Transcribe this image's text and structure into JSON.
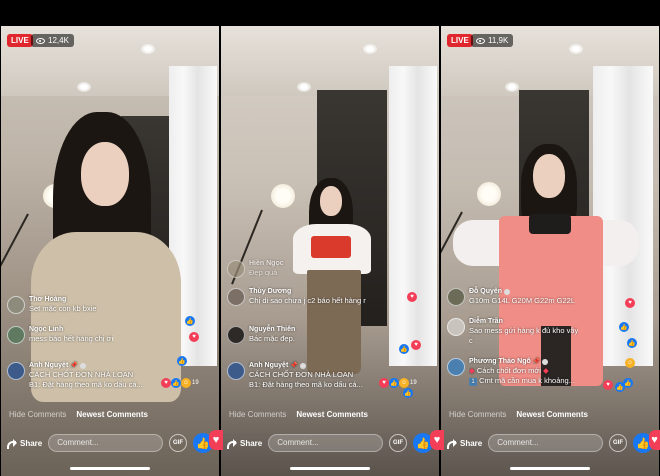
{
  "panels": [
    {
      "live_label": "LIVE",
      "viewers": "12,4K",
      "comments": [
        {
          "name": "Thơ Hoàng",
          "text": "Set mặc con kb bxie",
          "avatar_color": "#8d8b7c"
        },
        {
          "name": "Ngọc Linh",
          "text": "mess báo hết hàng chị ơi",
          "avatar_color": "#5f7a61"
        },
        {
          "name": "Anh Nguyệt",
          "text_line1": "CÁCH CHỐT ĐƠN NHÀ LOAN",
          "text_line2": "B1: Đặt hàng theo mã ko dấu cá...",
          "avatar_color": "#3c5a8a",
          "pinned": true
        }
      ],
      "react_count": "19",
      "tabs": {
        "hide": "Hide Comments",
        "newest": "Newest Comments"
      },
      "bottom": {
        "share": "Share",
        "comment_placeholder": "Comment...",
        "gif": "GIF"
      }
    },
    {
      "live_label": "",
      "viewers": "",
      "comments": [
        {
          "name": "Hiền Ngọc",
          "text": "Đẹp quá",
          "avatar_color": "#9a8f7a",
          "dim": true
        },
        {
          "name": "Thùy Dương",
          "text": "Chị di sao chưa j c2 báo hết hàng r",
          "avatar_color": "#7c6f66"
        },
        {
          "name": "Nguyễn Thiên",
          "text": "Bác mặc đẹp.",
          "avatar_color": "#2e2a27"
        },
        {
          "name": "Anh Nguyệt",
          "text_line1": "CÁCH CHỐT ĐƠN NHÀ LOAN",
          "text_line2": "B1: Đặt hàng theo mã ko dấu cá...",
          "avatar_color": "#3c5a8a",
          "pinned": true
        }
      ],
      "react_count": "19",
      "tabs": {
        "hide": "Hide Comments",
        "newest": "Newest Comments"
      },
      "bottom": {
        "share": "Share",
        "comment_placeholder": "Comment...",
        "gif": "GIF"
      }
    },
    {
      "live_label": "LIVE",
      "viewers": "11,9K",
      "comments": [
        {
          "name": "Đỗ Quyên",
          "text": "G10m G14L G20M G22m G22L",
          "avatar_color": "#6b6c58"
        },
        {
          "name": "Diễm Trần",
          "text_line1": "Sao mess gửi hàng k đủ kho vậy",
          "text_line2": "c",
          "avatar_color": "#c9c3bd"
        },
        {
          "name": "Phương Thảo Ngô",
          "text_line1": "Cách chốt đơn mới",
          "text_line2": "Cmt mã cần mua k khoảng...",
          "avatar_color": "#4a7fb0",
          "pinned": true
        }
      ],
      "tabs": {
        "hide": "Hide Comments",
        "newest": "Newest Comments"
      },
      "bottom": {
        "share": "Share",
        "comment_placeholder": "Comment...",
        "gif": "GIF"
      }
    }
  ],
  "icons": {
    "eye": "eye-icon",
    "share": "share-arrow-icon",
    "like": "thumbs-up-icon",
    "love": "heart-icon",
    "gif": "gif-icon"
  },
  "colors": {
    "live": "#e0272d",
    "like": "#1877f2",
    "love": "#f33e58"
  }
}
